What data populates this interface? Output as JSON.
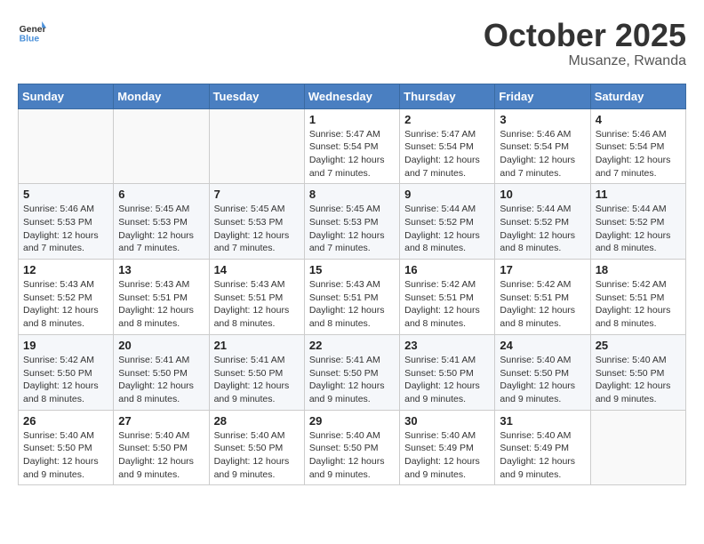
{
  "header": {
    "logo_text_general": "General",
    "logo_text_blue": "Blue",
    "month": "October 2025",
    "location": "Musanze, Rwanda"
  },
  "weekdays": [
    "Sunday",
    "Monday",
    "Tuesday",
    "Wednesday",
    "Thursday",
    "Friday",
    "Saturday"
  ],
  "weeks": [
    [
      {
        "day": "",
        "info": ""
      },
      {
        "day": "",
        "info": ""
      },
      {
        "day": "",
        "info": ""
      },
      {
        "day": "1",
        "info": "Sunrise: 5:47 AM\nSunset: 5:54 PM\nDaylight: 12 hours\nand 7 minutes."
      },
      {
        "day": "2",
        "info": "Sunrise: 5:47 AM\nSunset: 5:54 PM\nDaylight: 12 hours\nand 7 minutes."
      },
      {
        "day": "3",
        "info": "Sunrise: 5:46 AM\nSunset: 5:54 PM\nDaylight: 12 hours\nand 7 minutes."
      },
      {
        "day": "4",
        "info": "Sunrise: 5:46 AM\nSunset: 5:54 PM\nDaylight: 12 hours\nand 7 minutes."
      }
    ],
    [
      {
        "day": "5",
        "info": "Sunrise: 5:46 AM\nSunset: 5:53 PM\nDaylight: 12 hours\nand 7 minutes."
      },
      {
        "day": "6",
        "info": "Sunrise: 5:45 AM\nSunset: 5:53 PM\nDaylight: 12 hours\nand 7 minutes."
      },
      {
        "day": "7",
        "info": "Sunrise: 5:45 AM\nSunset: 5:53 PM\nDaylight: 12 hours\nand 7 minutes."
      },
      {
        "day": "8",
        "info": "Sunrise: 5:45 AM\nSunset: 5:53 PM\nDaylight: 12 hours\nand 7 minutes."
      },
      {
        "day": "9",
        "info": "Sunrise: 5:44 AM\nSunset: 5:52 PM\nDaylight: 12 hours\nand 8 minutes."
      },
      {
        "day": "10",
        "info": "Sunrise: 5:44 AM\nSunset: 5:52 PM\nDaylight: 12 hours\nand 8 minutes."
      },
      {
        "day": "11",
        "info": "Sunrise: 5:44 AM\nSunset: 5:52 PM\nDaylight: 12 hours\nand 8 minutes."
      }
    ],
    [
      {
        "day": "12",
        "info": "Sunrise: 5:43 AM\nSunset: 5:52 PM\nDaylight: 12 hours\nand 8 minutes."
      },
      {
        "day": "13",
        "info": "Sunrise: 5:43 AM\nSunset: 5:51 PM\nDaylight: 12 hours\nand 8 minutes."
      },
      {
        "day": "14",
        "info": "Sunrise: 5:43 AM\nSunset: 5:51 PM\nDaylight: 12 hours\nand 8 minutes."
      },
      {
        "day": "15",
        "info": "Sunrise: 5:43 AM\nSunset: 5:51 PM\nDaylight: 12 hours\nand 8 minutes."
      },
      {
        "day": "16",
        "info": "Sunrise: 5:42 AM\nSunset: 5:51 PM\nDaylight: 12 hours\nand 8 minutes."
      },
      {
        "day": "17",
        "info": "Sunrise: 5:42 AM\nSunset: 5:51 PM\nDaylight: 12 hours\nand 8 minutes."
      },
      {
        "day": "18",
        "info": "Sunrise: 5:42 AM\nSunset: 5:51 PM\nDaylight: 12 hours\nand 8 minutes."
      }
    ],
    [
      {
        "day": "19",
        "info": "Sunrise: 5:42 AM\nSunset: 5:50 PM\nDaylight: 12 hours\nand 8 minutes."
      },
      {
        "day": "20",
        "info": "Sunrise: 5:41 AM\nSunset: 5:50 PM\nDaylight: 12 hours\nand 8 minutes."
      },
      {
        "day": "21",
        "info": "Sunrise: 5:41 AM\nSunset: 5:50 PM\nDaylight: 12 hours\nand 9 minutes."
      },
      {
        "day": "22",
        "info": "Sunrise: 5:41 AM\nSunset: 5:50 PM\nDaylight: 12 hours\nand 9 minutes."
      },
      {
        "day": "23",
        "info": "Sunrise: 5:41 AM\nSunset: 5:50 PM\nDaylight: 12 hours\nand 9 minutes."
      },
      {
        "day": "24",
        "info": "Sunrise: 5:40 AM\nSunset: 5:50 PM\nDaylight: 12 hours\nand 9 minutes."
      },
      {
        "day": "25",
        "info": "Sunrise: 5:40 AM\nSunset: 5:50 PM\nDaylight: 12 hours\nand 9 minutes."
      }
    ],
    [
      {
        "day": "26",
        "info": "Sunrise: 5:40 AM\nSunset: 5:50 PM\nDaylight: 12 hours\nand 9 minutes."
      },
      {
        "day": "27",
        "info": "Sunrise: 5:40 AM\nSunset: 5:50 PM\nDaylight: 12 hours\nand 9 minutes."
      },
      {
        "day": "28",
        "info": "Sunrise: 5:40 AM\nSunset: 5:50 PM\nDaylight: 12 hours\nand 9 minutes."
      },
      {
        "day": "29",
        "info": "Sunrise: 5:40 AM\nSunset: 5:50 PM\nDaylight: 12 hours\nand 9 minutes."
      },
      {
        "day": "30",
        "info": "Sunrise: 5:40 AM\nSunset: 5:49 PM\nDaylight: 12 hours\nand 9 minutes."
      },
      {
        "day": "31",
        "info": "Sunrise: 5:40 AM\nSunset: 5:49 PM\nDaylight: 12 hours\nand 9 minutes."
      },
      {
        "day": "",
        "info": ""
      }
    ]
  ]
}
